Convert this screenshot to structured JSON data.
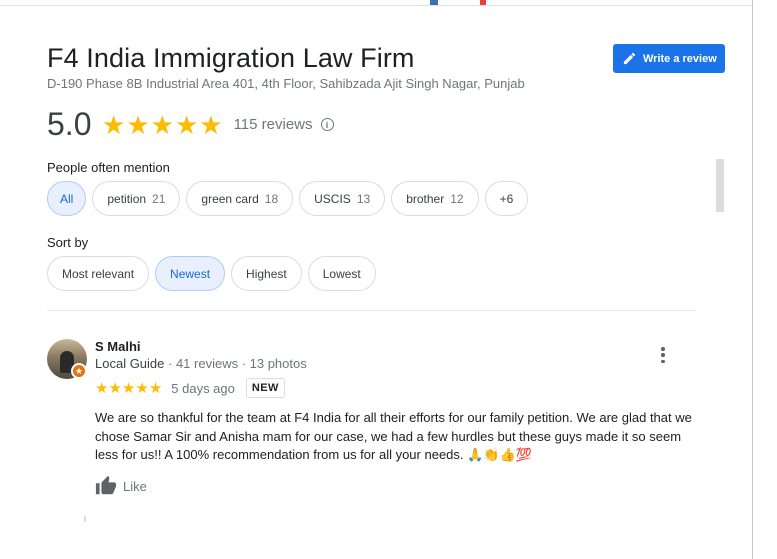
{
  "business": {
    "name": "F4 India Immigration Law Firm",
    "address": "D-190 Phase 8B Industrial Area 401, 4th Floor, Sahibzada Ajit Singh Nagar, Punjab"
  },
  "actions": {
    "write_review_label": "Write a review"
  },
  "rating": {
    "value": "5.0",
    "stars": 5,
    "count_label": "115 reviews",
    "info_glyph": "i"
  },
  "mentions": {
    "label": "People often mention",
    "chips": [
      {
        "label": "All",
        "count": "",
        "selected": true
      },
      {
        "label": "petition",
        "count": "21",
        "selected": false
      },
      {
        "label": "green card",
        "count": "18",
        "selected": false
      },
      {
        "label": "USCIS",
        "count": "13",
        "selected": false
      },
      {
        "label": "brother",
        "count": "12",
        "selected": false
      },
      {
        "label": "+6",
        "count": "",
        "selected": false
      }
    ]
  },
  "sort": {
    "label": "Sort by",
    "options": [
      {
        "label": "Most relevant",
        "selected": false
      },
      {
        "label": "Newest",
        "selected": true
      },
      {
        "label": "Highest",
        "selected": false
      },
      {
        "label": "Lowest",
        "selected": false
      }
    ]
  },
  "review": {
    "author": "S Malhi",
    "badge": "Local Guide",
    "stats": " · 41 reviews · 13 photos",
    "stars": 5,
    "date": "5 days ago",
    "new_label": "NEW",
    "text": "We are so thankful for the team at F4 India for all their efforts for our family petition. We are glad that we chose Samar Sir and Anisha mam for our case, we had a few hurdles but these guys made it so seem less for us!! A 100% recommendation from us for all your needs. 🙏👏👍💯",
    "like_label": "Like"
  },
  "colors": {
    "accent": "#1a73e8",
    "star": "#fbbc04",
    "selected_chip_bg": "#e8f0fe",
    "muted_text": "#70757a"
  }
}
